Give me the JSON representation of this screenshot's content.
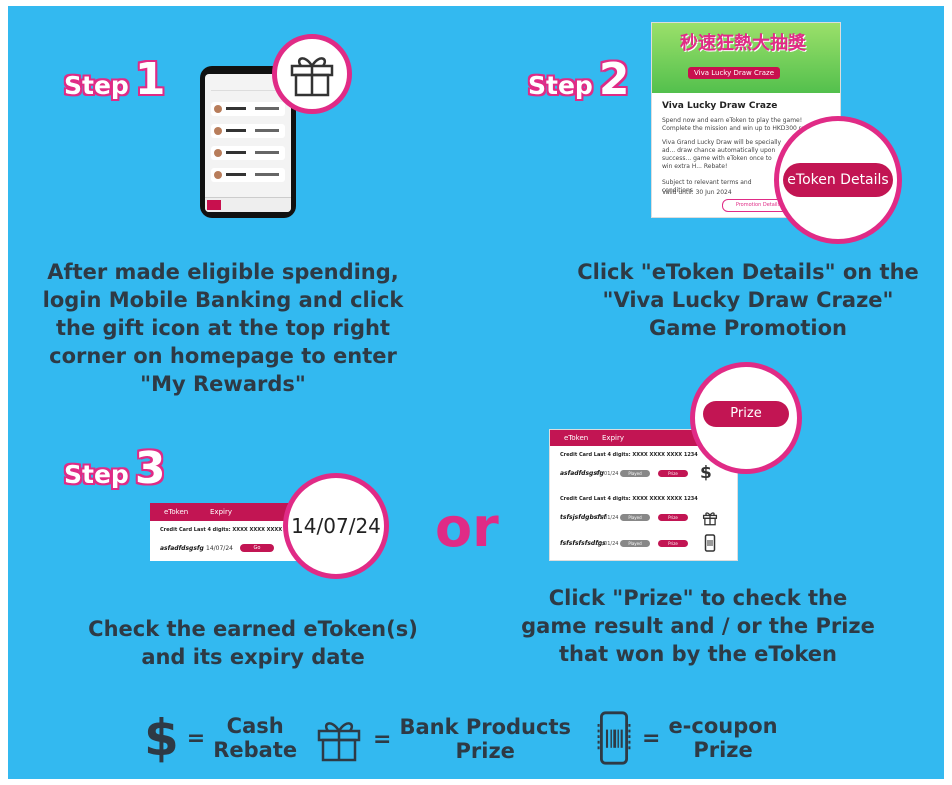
{
  "colors": {
    "background": "#33b9f0",
    "accent_pink": "#e02b86",
    "crimson": "#c21553",
    "text_dark": "#2e3a45"
  },
  "step1": {
    "word": "Step",
    "number": "1",
    "description": "After made eligible spending,\nlogin Mobile Banking and click\nthe gift icon at the top right\ncorner on homepage to enter\n\"My Rewards\"",
    "icon": "gift-icon"
  },
  "step2": {
    "word": "Step",
    "number": "2",
    "promo_banner": "秒速狂熱大抽獎",
    "promo_banner_sub": "Viva Lucky Draw Craze",
    "promo_title": "Viva Lucky Draw Craze",
    "promo_line1": "Spend now and earn eToken to play the game! Complete the mission and win up to HKD300 reward!",
    "promo_line2": "Viva Grand Lucky Draw will be specially ad... draw chance automatically upon success... game with eToken once to win extra H... Rebate!",
    "promo_line3": "Subject to relevant terms and conditions",
    "promo_valid": "Valid until: 30 Jun 2024",
    "promo_button": "Promotion Details",
    "button": "eToken Details",
    "description": "Click \"eToken Details\" on the\n\"Viva Lucky Draw Craze\"\nGame Promotion"
  },
  "step3": {
    "word": "Step",
    "number": "3",
    "table_head_1": "eToken",
    "table_head_2": "Expiry",
    "table_subhead": "Credit Card Last 4 digits: XXXX XXXX XXXX 1000",
    "token_code": "asfadfdsgsfg",
    "token_date": "14/07/24",
    "token_button": "Go",
    "magnified_date": "14/07/24",
    "description": "Check the earned eToken(s)\nand its expiry date"
  },
  "or_text": "or",
  "step4": {
    "button": "Prize",
    "table_head_1": "eToken",
    "table_head_2": "Expiry",
    "rows": [
      {
        "subhead": "Credit Card Last 4 digits: XXXX XXXX XXXX 1234",
        "name": "asfadfdsgsfg",
        "date": "01/01/24",
        "played": "Played",
        "prize": "Prize",
        "icon": "dollar-icon",
        "glyph": "$"
      },
      {
        "subhead": "Credit Card Last 4 digits: XXXX XXXX XXXX 1234",
        "name": "tsfsjsfdgbsfsf",
        "date": "01/01/24",
        "played": "Played",
        "prize": "Prize",
        "icon": "gift-icon",
        "glyph": ""
      },
      {
        "subhead": "",
        "name": "fsfsfsfsfsdfgs",
        "date": "01/01/24",
        "played": "Played",
        "prize": "Prize",
        "icon": "coupon-phone-icon",
        "glyph": ""
      }
    ],
    "description": "Click \"Prize\" to check the\ngame result and / or the Prize\nthat won by the eToken"
  },
  "legend": [
    {
      "icon": "dollar-icon",
      "eq": "=",
      "label": "Cash\nRebate"
    },
    {
      "icon": "gift-icon",
      "eq": "=",
      "label": "Bank Products\nPrize"
    },
    {
      "icon": "coupon-phone-icon",
      "eq": "=",
      "label": "e-coupon\nPrize"
    }
  ]
}
